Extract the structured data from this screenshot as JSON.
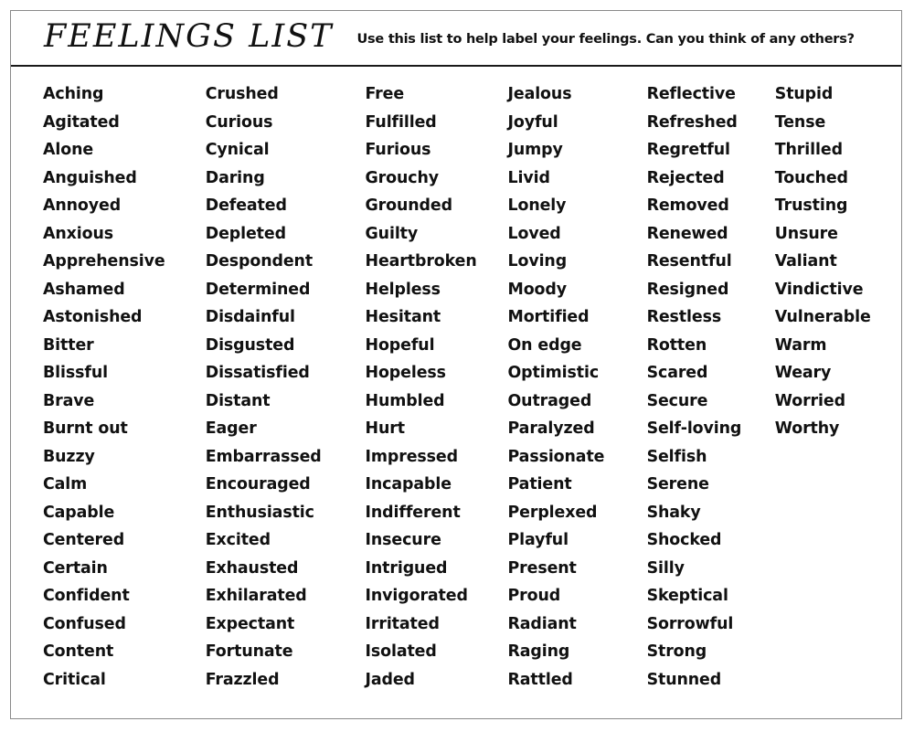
{
  "header": {
    "title": "FEELINGS LIST",
    "subtitle": "Use this list to help label your feelings. Can you think of any others?"
  },
  "colors": {
    "text": "#111111",
    "frame_border": "#8a8a8a",
    "header_rule": "#1a1a1a",
    "background": "#ffffff"
  },
  "columns": [
    {
      "index": 1,
      "items": [
        "Aching",
        "Agitated",
        "Alone",
        "Anguished",
        "Annoyed",
        "Anxious",
        "Apprehensive",
        "Ashamed",
        "Astonished",
        "Bitter",
        "Blissful",
        "Brave",
        "Burnt out",
        "Buzzy",
        "Calm",
        "Capable",
        "Centered",
        "Certain",
        "Confident",
        "Confused",
        "Content",
        "Critical"
      ]
    },
    {
      "index": 2,
      "items": [
        "Crushed",
        "Curious",
        "Cynical",
        "Daring",
        "Defeated",
        "Depleted",
        "Despondent",
        "Determined",
        "Disdainful",
        "Disgusted",
        "Dissatisfied",
        "Distant",
        "Eager",
        "Embarrassed",
        "Encouraged",
        "Enthusiastic",
        "Excited",
        "Exhausted",
        "Exhilarated",
        "Expectant",
        "Fortunate",
        "Frazzled"
      ]
    },
    {
      "index": 3,
      "items": [
        "Free",
        "Fulfilled",
        "Furious",
        "Grouchy",
        "Grounded",
        "Guilty",
        "Heartbroken",
        "Helpless",
        "Hesitant",
        "Hopeful",
        "Hopeless",
        "Humbled",
        "Hurt",
        "Impressed",
        "Incapable",
        "Indifferent",
        "Insecure",
        "Intrigued",
        "Invigorated",
        "Irritated",
        "Isolated",
        "Jaded"
      ]
    },
    {
      "index": 4,
      "items": [
        "Jealous",
        "Joyful",
        "Jumpy",
        "Livid",
        "Lonely",
        "Loved",
        "Loving",
        "Moody",
        "Mortified",
        "On edge",
        "Optimistic",
        "Outraged",
        "Paralyzed",
        "Passionate",
        "Patient",
        "Perplexed",
        "Playful",
        "Present",
        "Proud",
        "Radiant",
        "Raging",
        "Rattled"
      ]
    },
    {
      "index": 5,
      "items": [
        "Reflective",
        "Refreshed",
        "Regretful",
        "Rejected",
        "Removed",
        "Renewed",
        "Resentful",
        "Resigned",
        "Restless",
        "Rotten",
        "Scared",
        "Secure",
        "Self-loving",
        "Selfish",
        "Serene",
        "Shaky",
        "Shocked",
        "Silly",
        "Skeptical",
        "Sorrowful",
        "Strong",
        "Stunned"
      ]
    },
    {
      "index": 6,
      "items": [
        "Stupid",
        "Tense",
        "Thrilled",
        "Touched",
        "Trusting",
        "Unsure",
        "Valiant",
        "Vindictive",
        "Vulnerable",
        "Warm",
        "Weary",
        "Worried",
        "Worthy"
      ]
    }
  ]
}
